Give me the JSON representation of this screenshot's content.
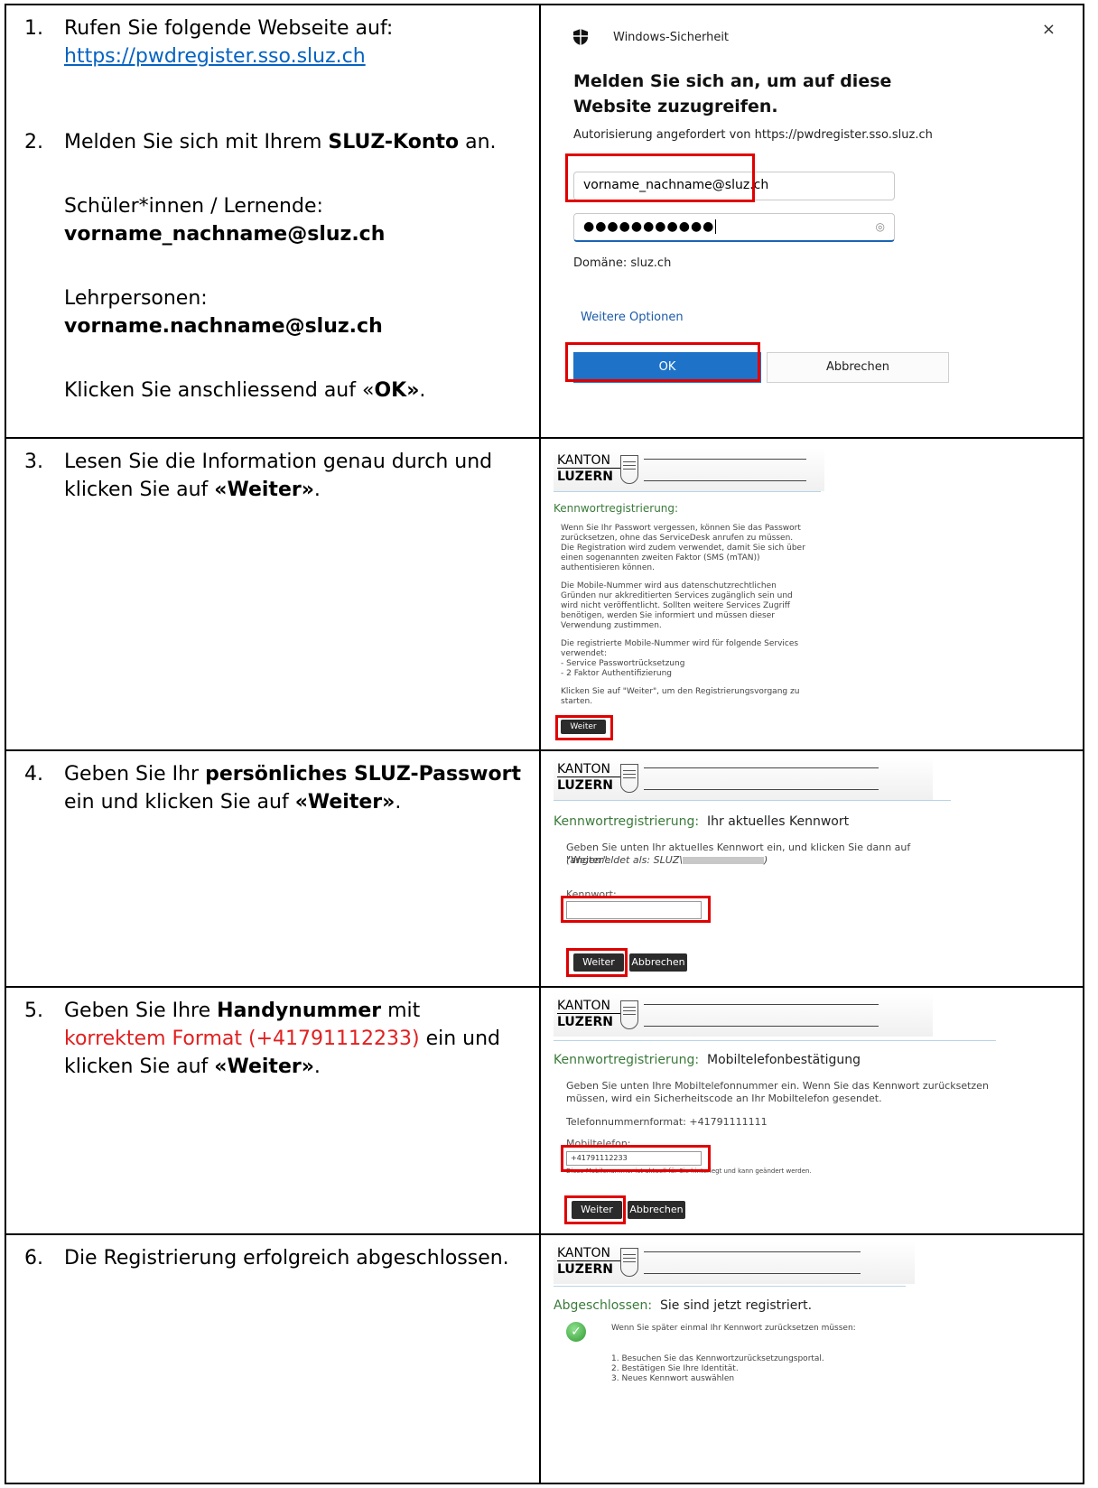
{
  "steps": {
    "s1": {
      "num": "1.",
      "line1": "Rufen Sie folgende Webseite auf:",
      "link": "https://pwdregister.sso.sluz.ch"
    },
    "s2": {
      "num": "2.",
      "pre": "Melden Sie sich mit Ihrem ",
      "bold": "SLUZ-Konto",
      "post": " an.",
      "students_label": "Schüler*innen / Lernende:",
      "students_email": "vorname_nachname@sluz.ch",
      "teachers_label": "Lehrpersonen:",
      "teachers_email": "vorname.nachname@sluz.ch",
      "click_pre": "Klicken Sie anschliessend auf «",
      "click_bold": "OK»",
      "click_post": "."
    },
    "s3": {
      "num": "3.",
      "line1": "Lesen Sie die Information genau durch und",
      "line2_pre": "klicken Sie auf ",
      "line2_bold": "«Weiter»",
      "line2_post": "."
    },
    "s4": {
      "num": "4.",
      "pre": "Geben Sie Ihr ",
      "bold": "persönliches SLUZ-Passwort",
      "line2_pre": "ein und klicken Sie auf ",
      "line2_bold": "«Weiter»",
      "line2_post": "."
    },
    "s5": {
      "num": "5.",
      "pre": "Geben Sie Ihre ",
      "bold": "Handynummer",
      "post": " mit",
      "red": "korrektem Format (+41791112233)",
      "line2_post": " ein und",
      "line3_pre": "klicken Sie auf ",
      "line3_bold": "«Weiter»",
      "line3_post": "."
    },
    "s6": {
      "num": "6.",
      "line1": "Die Registrierung erfolgreich abgeschlossen."
    }
  },
  "dialog": {
    "title": "Windows-Sicherheit",
    "close": "×",
    "heading": "Melden Sie sich an, um auf diese Website zuzugreifen.",
    "auth": "Autorisierung angefordert von https://pwdregister.sso.sluz.ch",
    "username": "vorname_nachname@sluz.ch",
    "password_dots": "●●●●●●●●●●●",
    "domain": "Domäne: sluz.ch",
    "more": "Weitere Optionen",
    "ok": "OK",
    "cancel": "Abbrechen",
    "eye_icon": "eye-icon",
    "shield_icon": "shield-icon"
  },
  "kanton": {
    "line1": "KANTON",
    "line2": "LUZERN"
  },
  "shot3": {
    "title": "Kennwortregistrierung:",
    "p1": "Wenn Sie Ihr Passwort vergessen, können Sie das Passwort zurücksetzen, ohne das ServiceDesk anrufen zu müssen. Die Registration wird zudem verwendet, damit Sie sich über einen sogenannten zweiten Faktor (SMS (mTAN)) authentisieren können.",
    "p2": "Die Mobile-Nummer wird aus datenschutzrechtlichen Gründen nur akkreditierten Services zugänglich sein und wird nicht veröffentlicht. Sollten weitere Services Zugriff benötigen, werden Sie informiert und müssen dieser Verwendung zustimmen.",
    "p3a": "Die registrierte Mobile-Nummer wird für folgende Services verwendet:",
    "p3b": "- Service Passwortrücksetzung",
    "p3c": "- 2 Faktor Authentifizierung",
    "p4": "Klicken Sie auf \"Weiter\", um den Registrierungsvorgang zu starten.",
    "btn": "Weiter"
  },
  "shot4": {
    "title": "Kennwortregistrierung:",
    "subtitle": "Ihr aktuelles Kennwort",
    "text": "Geben Sie unten Ihr aktuelles Kennwort ein, und klicken Sie dann auf \"Weiter\".",
    "logged_in": "(angemeldet als: SLUZ\\",
    "field_label": "Kennwort:",
    "next": "Weiter",
    "cancel": "Abbrechen"
  },
  "shot5": {
    "title": "Kennwortregistrierung:",
    "subtitle": "Mobiltelefonbestätigung",
    "text": "Geben Sie unten Ihre Mobiltelefonnummer ein. Wenn Sie das Kennwort zurücksetzen müssen, wird ein Sicherheitscode an Ihr Mobiltelefon gesendet.",
    "format": "Telefonnummernformat: +41791111111",
    "field_label": "Mobiltelefon:",
    "field_value": "+41791112233",
    "hint": "Diese Mobilenummer ist aktuell für Sie hinterlegt und kann geändert werden.",
    "next": "Weiter",
    "cancel": "Abbrechen"
  },
  "shot6": {
    "title": "Abgeschlossen:",
    "subtitle": "Sie sind jetzt registriert.",
    "line1": "Wenn Sie später einmal Ihr Kennwort zurücksetzen müssen:",
    "i1": "1. Besuchen Sie das Kennwortzurücksetzungsportal.",
    "i2": "2. Bestätigen Sie Ihre Identität.",
    "i3": "3. Neues Kennwort auswählen",
    "check_icon": "checkmark-icon"
  }
}
